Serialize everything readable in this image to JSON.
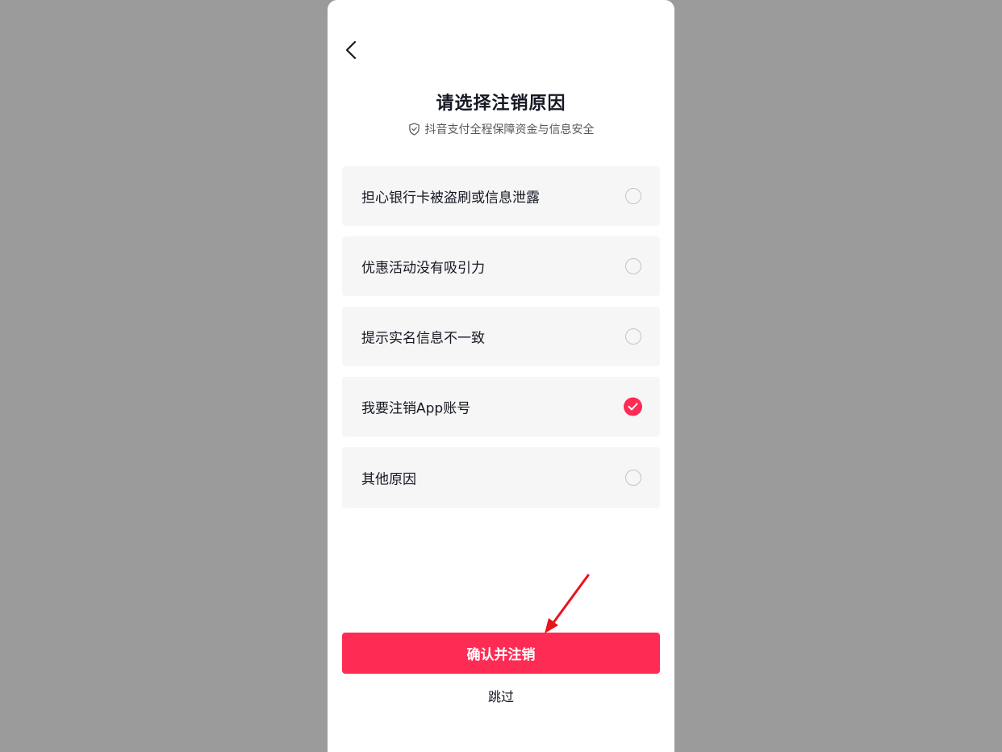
{
  "header": {
    "back_icon": "chevron-left-icon",
    "title": "请选择注销原因",
    "subtitle_icon": "shield-check-icon",
    "subtitle": "抖音支付全程保障资金与信息安全"
  },
  "options": [
    {
      "label": "担心银行卡被盗刷或信息泄露",
      "selected": false
    },
    {
      "label": "优惠活动没有吸引力",
      "selected": false
    },
    {
      "label": "提示实名信息不一致",
      "selected": false
    },
    {
      "label": "我要注销App账号",
      "selected": true
    },
    {
      "label": "其他原因",
      "selected": false
    }
  ],
  "actions": {
    "confirm_label": "确认并注销",
    "skip_label": "跳过"
  },
  "colors": {
    "accent": "#fe2c55",
    "annotation_arrow": "#e8141c"
  }
}
